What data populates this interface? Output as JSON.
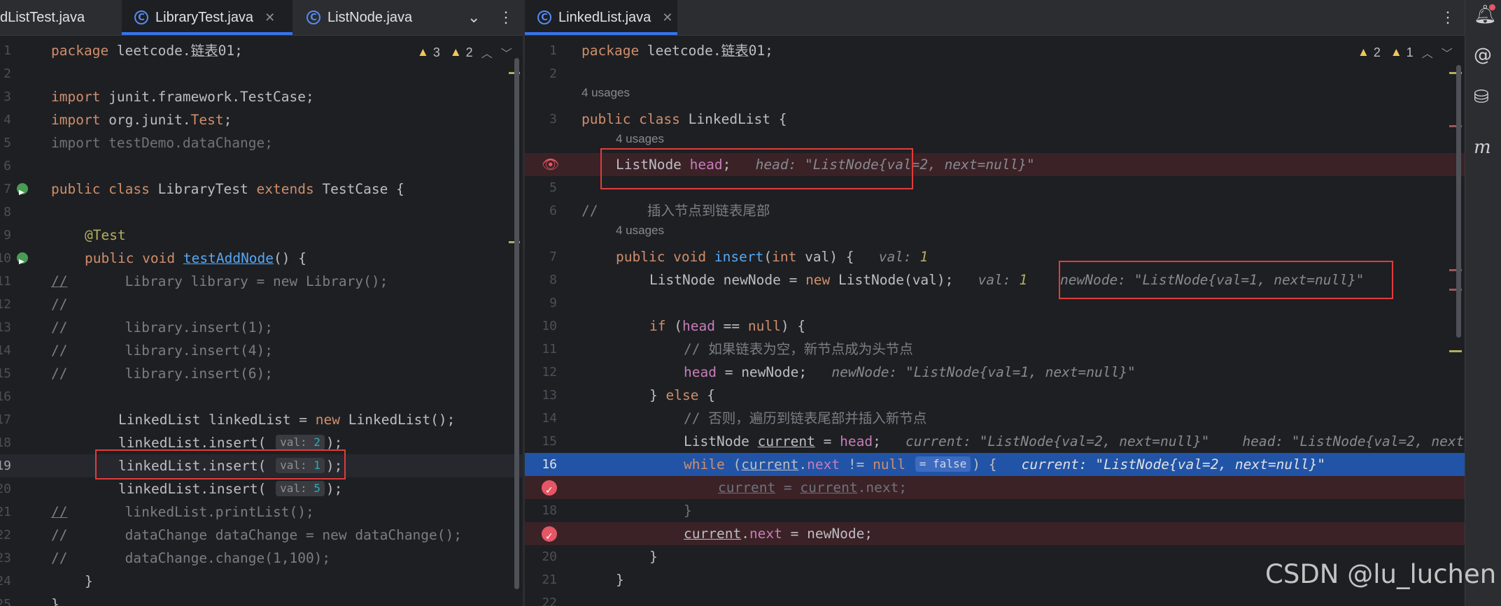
{
  "left": {
    "tabs": [
      {
        "label": "dListTest.java",
        "active": false
      },
      {
        "label": "LibraryTest.java",
        "active": true,
        "closable": true
      },
      {
        "label": "ListNode.java",
        "active": false
      }
    ],
    "warnings": {
      "warn_count": "3",
      "weak_count": "2"
    }
  },
  "right": {
    "tabs": [
      {
        "label": "LinkedList.java",
        "active": true,
        "closable": true
      }
    ],
    "warnings": {
      "warn_count": "2",
      "weak_count": "1"
    }
  },
  "watermark": "CSDN @lu_luchen",
  "icons": {
    "notifications": "bell-icon",
    "ai_assistant": "spiral-icon",
    "database": "database-icon",
    "maven": "maven-icon"
  },
  "colors": {
    "exec_line": "#2154a6",
    "breakpoint_line": "#3b2226",
    "highlight_box": "#e03c3c",
    "tab_accent": "#3574f0"
  }
}
